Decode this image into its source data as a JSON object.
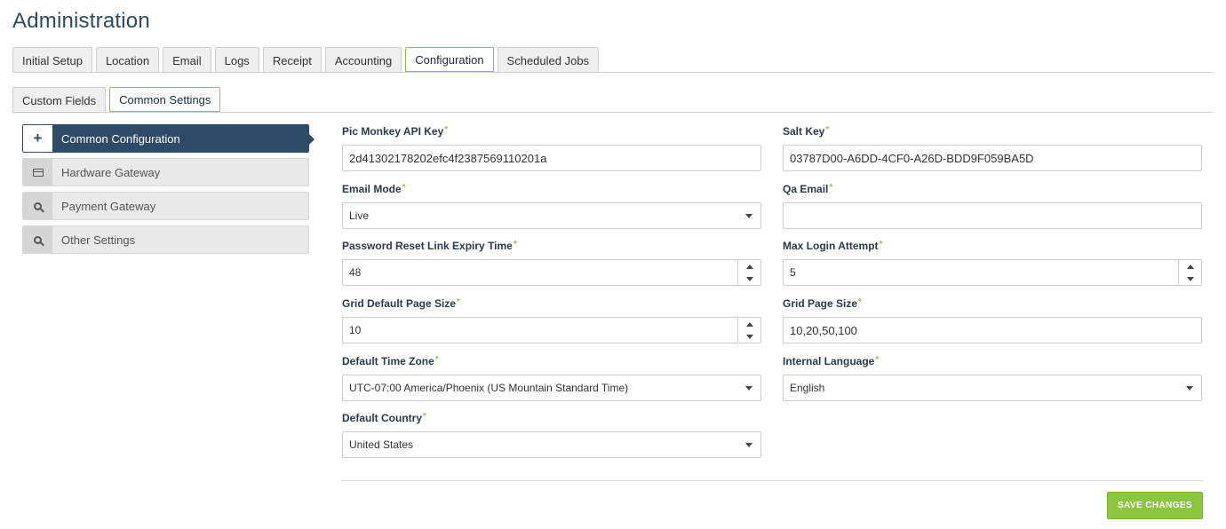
{
  "page": {
    "title": "Administration"
  },
  "main_tabs": [
    {
      "label": "Initial Setup"
    },
    {
      "label": "Location"
    },
    {
      "label": "Email"
    },
    {
      "label": "Logs"
    },
    {
      "label": "Receipt"
    },
    {
      "label": "Accounting"
    },
    {
      "label": "Configuration",
      "active": true
    },
    {
      "label": "Scheduled Jobs"
    }
  ],
  "sub_tabs": [
    {
      "label": "Custom Fields"
    },
    {
      "label": "Common Settings",
      "active": true
    }
  ],
  "side_nav": [
    {
      "label": "Common Configuration",
      "icon": "plus-icon",
      "active": true
    },
    {
      "label": "Hardware Gateway",
      "icon": "card-icon"
    },
    {
      "label": "Payment Gateway",
      "icon": "search-icon"
    },
    {
      "label": "Other Settings",
      "icon": "search-icon"
    }
  ],
  "form": {
    "pic_monkey_api_key": {
      "label": "Pic Monkey API Key",
      "value": "2d41302178202efc4f2387569110201a"
    },
    "salt_key": {
      "label": "Salt Key",
      "value": "03787D00-A6DD-4CF0-A26D-BDD9F059BA5D"
    },
    "email_mode": {
      "label": "Email Mode",
      "value": "Live"
    },
    "qa_email": {
      "label": "Qa Email",
      "value": ""
    },
    "password_reset_expiry": {
      "label": "Password Reset Link Expiry Time",
      "value": "48"
    },
    "max_login_attempt": {
      "label": "Max Login Attempt",
      "value": "5"
    },
    "grid_default_page_size": {
      "label": "Grid Default Page Size",
      "value": "10"
    },
    "grid_page_size": {
      "label": "Grid Page Size",
      "value": "10,20,50,100"
    },
    "default_time_zone": {
      "label": "Default Time Zone",
      "value": "UTC-07:00 America/Phoenix (US Mountain Standard Time)"
    },
    "internal_language": {
      "label": "Internal Language",
      "value": "English"
    },
    "default_country": {
      "label": "Default Country",
      "value": "United States"
    },
    "required_marker": "*"
  },
  "actions": {
    "save_label": "SAVE CHANGES"
  },
  "colors": {
    "accent": "#8cc63f",
    "nav_active": "#2d4a66",
    "title": "#2e4a62"
  }
}
